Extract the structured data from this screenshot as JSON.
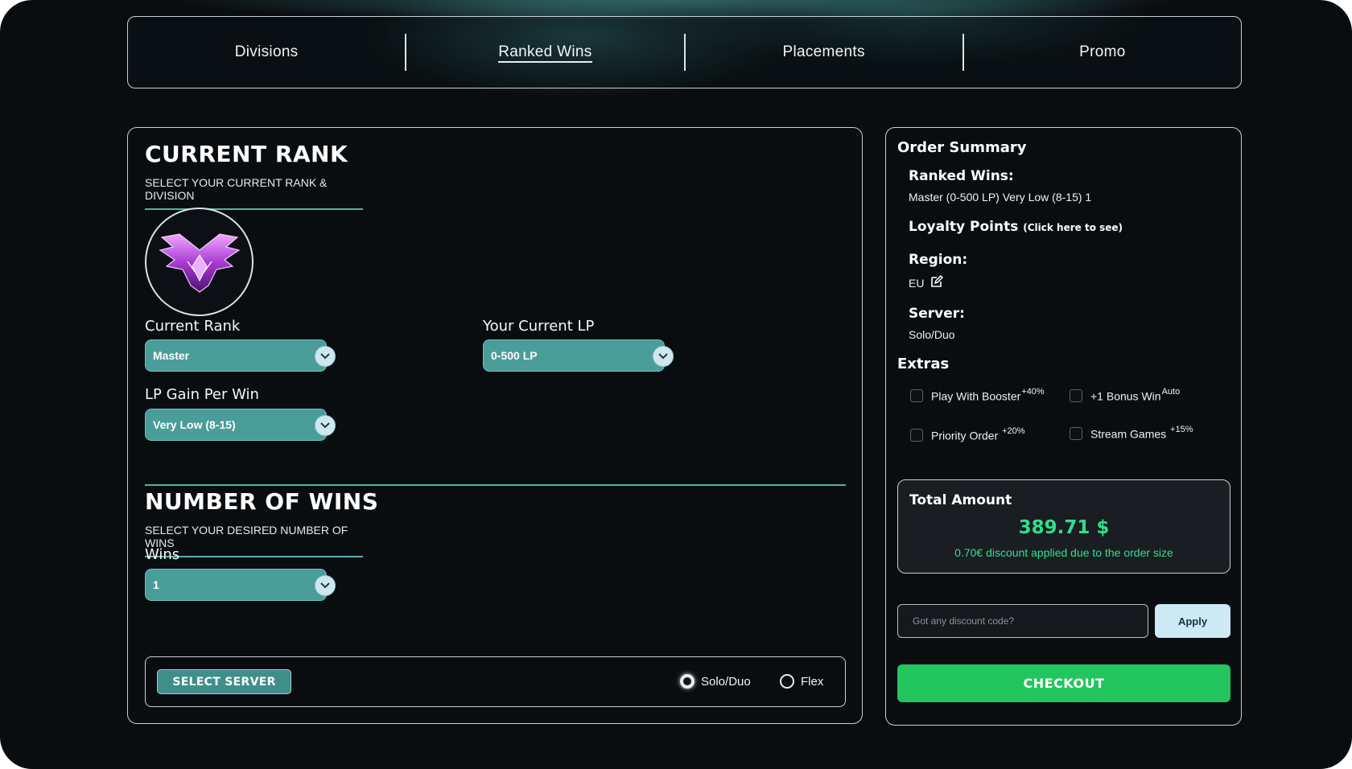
{
  "nav": {
    "tabs": [
      {
        "label": "Divisions"
      },
      {
        "label": "Ranked Wins"
      },
      {
        "label": "Placements"
      },
      {
        "label": "Promo"
      }
    ]
  },
  "current_rank": {
    "title": "CURRENT RANK",
    "subtitle": "SELECT YOUR CURRENT RANK & DIVISION",
    "rank_label": "Current Rank",
    "rank_value": "Master",
    "lp_label": "Your Current LP",
    "lp_value": "0-500 LP",
    "gain_label": "LP Gain Per Win",
    "gain_value": "Very Low (8-15)"
  },
  "wins": {
    "title": "NUMBER OF WINS",
    "subtitle": "SELECT YOUR DESIRED NUMBER OF WINS",
    "label": "Wins",
    "value": "1"
  },
  "server": {
    "button_label": "SELECT SERVER",
    "options": [
      {
        "label": "Solo/Duo",
        "selected": true
      },
      {
        "label": "Flex",
        "selected": false
      }
    ]
  },
  "summary": {
    "title": "Order Summary",
    "ranked_wins_head": "Ranked Wins:",
    "ranked_wins_value": "Master (0-500 LP) Very Low (8-15) 1",
    "loyalty_head": "Loyalty Points",
    "loyalty_note": "(Click here to see)",
    "region_head": "Region:",
    "region_value": "EU",
    "server_head": "Server:",
    "server_value": "Solo/Duo",
    "extras_head": "Extras",
    "extras": [
      {
        "label": "Play With Booster",
        "badge": "+40%"
      },
      {
        "label": "+1 Bonus Win",
        "badge": "Auto"
      },
      {
        "label": "Priority Order",
        "badge": "+20%"
      },
      {
        "label": "Stream Games",
        "badge": "+15%"
      }
    ]
  },
  "total": {
    "label": "Total Amount",
    "price": "389.71 $",
    "discount_note": "0.70€ discount applied due to the order size"
  },
  "discount": {
    "placeholder": "Got any discount code?",
    "apply_label": "Apply"
  },
  "checkout": {
    "label": "CHECKOUT"
  },
  "colors": {
    "accent_teal": "#4a9d99",
    "price_green": "#2ee08a",
    "checkout_green": "#23c55e",
    "background": "#0a0d10"
  }
}
